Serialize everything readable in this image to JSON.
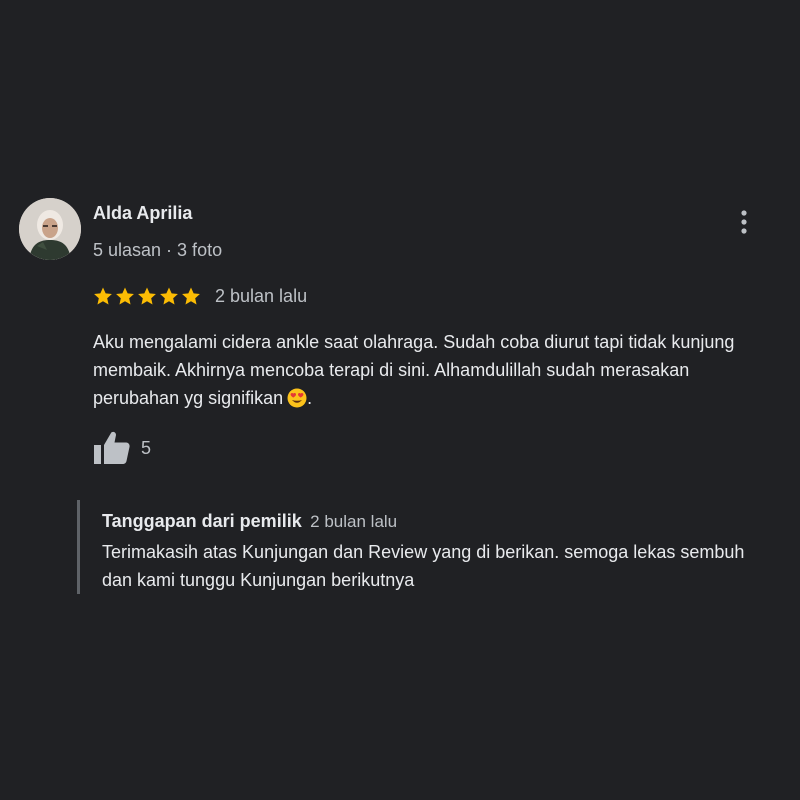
{
  "reviewer": {
    "name": "Alda Aprilia",
    "meta": "5 ulasan · 3 foto"
  },
  "review": {
    "rating": 5,
    "rating_max": 5,
    "date": "2 bulan lalu",
    "text": "Aku mengalami cidera ankle saat olahraga. Sudah coba diurut tapi tidak kunjung membaik. Akhirnya mencoba terapi di sini. Alhamdulillah sudah merasakan perubahan yg signifikan",
    "text_end": ".",
    "emoji": "heart-eyes-emoji",
    "like_count": "5"
  },
  "owner_response": {
    "title": "Tanggapan dari pemilik",
    "date": "2 bulan lalu",
    "text": "Terimakasih atas Kunjungan dan Review yang di berikan. semoga lekas sembuh dan kami tunggu Kunjungan berikutnya"
  },
  "icons": {
    "menu": "more-vert-icon",
    "star": "star-icon",
    "like": "thumbs-up-icon"
  },
  "colors": {
    "background": "#202124",
    "star": "#fbbc04",
    "text_primary": "#e8eaed",
    "text_secondary": "#bdc1c6",
    "divider": "#5f6368"
  }
}
